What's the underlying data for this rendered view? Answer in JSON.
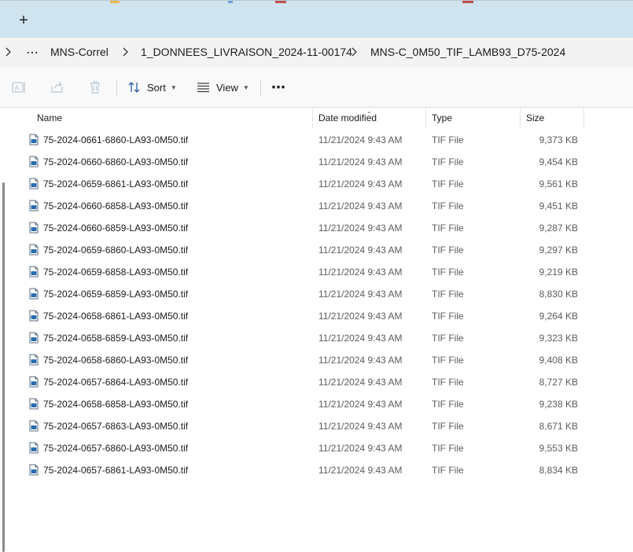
{
  "tabstrip": {
    "new_tab_label": "+"
  },
  "breadcrumb": {
    "overflow_label": "⋯",
    "items": [
      {
        "label": "MNS-Correl"
      },
      {
        "label": "1_DONNEES_LIVRAISON_2024-11-00174"
      },
      {
        "label": "MNS-C_0M50_TIF_LAMB93_D75-2024"
      }
    ]
  },
  "toolbar": {
    "sort_label": "Sort",
    "view_label": "View",
    "more_label": "⋯"
  },
  "columns": {
    "name": "Name",
    "date": "Date modified",
    "type": "Type",
    "size": "Size"
  },
  "files": [
    {
      "name": "75-2024-0661-6860-LA93-0M50.tif",
      "date": "11/21/2024 9:43 AM",
      "type": "TIF File",
      "size": "9,373 KB"
    },
    {
      "name": "75-2024-0660-6860-LA93-0M50.tif",
      "date": "11/21/2024 9:43 AM",
      "type": "TIF File",
      "size": "9,454 KB"
    },
    {
      "name": "75-2024-0659-6861-LA93-0M50.tif",
      "date": "11/21/2024 9:43 AM",
      "type": "TIF File",
      "size": "9,561 KB"
    },
    {
      "name": "75-2024-0660-6858-LA93-0M50.tif",
      "date": "11/21/2024 9:43 AM",
      "type": "TIF File",
      "size": "9,451 KB"
    },
    {
      "name": "75-2024-0660-6859-LA93-0M50.tif",
      "date": "11/21/2024 9:43 AM",
      "type": "TIF File",
      "size": "9,287 KB"
    },
    {
      "name": "75-2024-0659-6860-LA93-0M50.tif",
      "date": "11/21/2024 9:43 AM",
      "type": "TIF File",
      "size": "9,297 KB"
    },
    {
      "name": "75-2024-0659-6858-LA93-0M50.tif",
      "date": "11/21/2024 9:43 AM",
      "type": "TIF File",
      "size": "9,219 KB"
    },
    {
      "name": "75-2024-0659-6859-LA93-0M50.tif",
      "date": "11/21/2024 9:43 AM",
      "type": "TIF File",
      "size": "8,830 KB"
    },
    {
      "name": "75-2024-0658-6861-LA93-0M50.tif",
      "date": "11/21/2024 9:43 AM",
      "type": "TIF File",
      "size": "9,264 KB"
    },
    {
      "name": "75-2024-0658-6859-LA93-0M50.tif",
      "date": "11/21/2024 9:43 AM",
      "type": "TIF File",
      "size": "9,323 KB"
    },
    {
      "name": "75-2024-0658-6860-LA93-0M50.tif",
      "date": "11/21/2024 9:43 AM",
      "type": "TIF File",
      "size": "9,408 KB"
    },
    {
      "name": "75-2024-0657-6864-LA93-0M50.tif",
      "date": "11/21/2024 9:43 AM",
      "type": "TIF File",
      "size": "8,727 KB"
    },
    {
      "name": "75-2024-0658-6858-LA93-0M50.tif",
      "date": "11/21/2024 9:43 AM",
      "type": "TIF File",
      "size": "9,238 KB"
    },
    {
      "name": "75-2024-0657-6863-LA93-0M50.tif",
      "date": "11/21/2024 9:43 AM",
      "type": "TIF File",
      "size": "8,671 KB"
    },
    {
      "name": "75-2024-0657-6860-LA93-0M50.tif",
      "date": "11/21/2024 9:43 AM",
      "type": "TIF File",
      "size": "9,553 KB"
    },
    {
      "name": "75-2024-0657-6861-LA93-0M50.tif",
      "date": "11/21/2024 9:43 AM",
      "type": "TIF File",
      "size": "8,834 KB"
    }
  ],
  "icons": {
    "file": "tif-file-icon",
    "sort": "sort-arrows-icon",
    "view": "view-lines-icon",
    "rename": "rename-icon",
    "share": "share-icon",
    "delete": "trash-icon"
  },
  "colors": {
    "tabstrip_bg": "#cfe4ee",
    "address_bg": "#f3f3f3",
    "toolbar_bg": "#f9f9f9",
    "file_icon_accent": "#2b6cb0"
  }
}
